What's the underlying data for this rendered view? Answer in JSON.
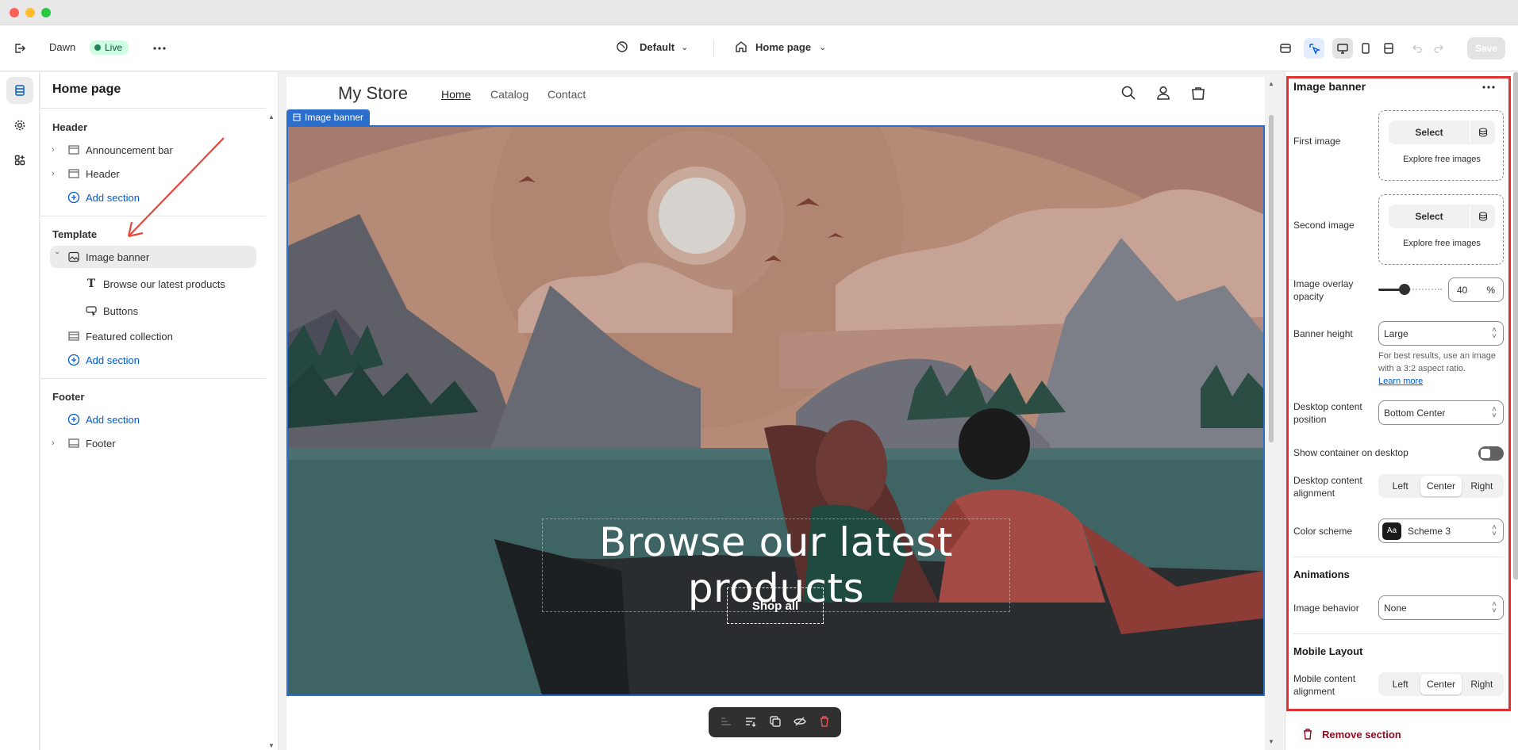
{
  "window": {
    "traffic_lights": [
      "#fe5f57",
      "#febc2e",
      "#28c840"
    ]
  },
  "topbar": {
    "theme_name": "Dawn",
    "live_label": "Live",
    "more_icon": "ellipsis-icon",
    "view_label": "Default",
    "page_label": "Home page",
    "save_label": "Save"
  },
  "sidebar": {
    "title": "Home page",
    "header_group": "Header",
    "header_items": [
      {
        "label": "Announcement bar"
      },
      {
        "label": "Header"
      }
    ],
    "add_section": "Add section",
    "template_group": "Template",
    "template_items": {
      "image_banner": "Image banner",
      "child_text": "Browse our latest products",
      "child_buttons": "Buttons",
      "featured": "Featured collection"
    },
    "footer_group": "Footer",
    "footer_item": "Footer"
  },
  "preview": {
    "store_name": "My Store",
    "nav": [
      "Home",
      "Catalog",
      "Contact"
    ],
    "banner_tag": "Image banner",
    "heading": "Browse our latest products",
    "button": "Shop all"
  },
  "panel": {
    "title": "Image banner",
    "first_image": "First image",
    "second_image": "Second image",
    "select_label": "Select",
    "explore_label": "Explore free images",
    "overlay_label": "Image overlay opacity",
    "overlay_value": "40",
    "overlay_unit": "%",
    "overlay_fraction": 0.4,
    "banner_height_label": "Banner height",
    "banner_height_value": "Large",
    "help_text": "For best results, use an image with a 3:2 aspect ratio.",
    "learn_more": "Learn more",
    "desktop_position_label": "Desktop content position",
    "desktop_position_value": "Bottom Center",
    "show_container_label": "Show container on desktop",
    "desktop_alignment_label": "Desktop content alignment",
    "alignment_options": [
      "Left",
      "Center",
      "Right"
    ],
    "color_scheme_label": "Color scheme",
    "color_scheme_swatch": "Aa",
    "color_scheme_value": "Scheme 3",
    "animations_heading": "Animations",
    "image_behavior_label": "Image behavior",
    "image_behavior_value": "None",
    "mobile_heading": "Mobile Layout",
    "mobile_alignment_label": "Mobile content alignment",
    "remove_section": "Remove section"
  },
  "colors": {
    "accent": "#2c6ecb",
    "link": "#005bd3",
    "highlight": "#e03131",
    "danger": "#8e0b21"
  }
}
